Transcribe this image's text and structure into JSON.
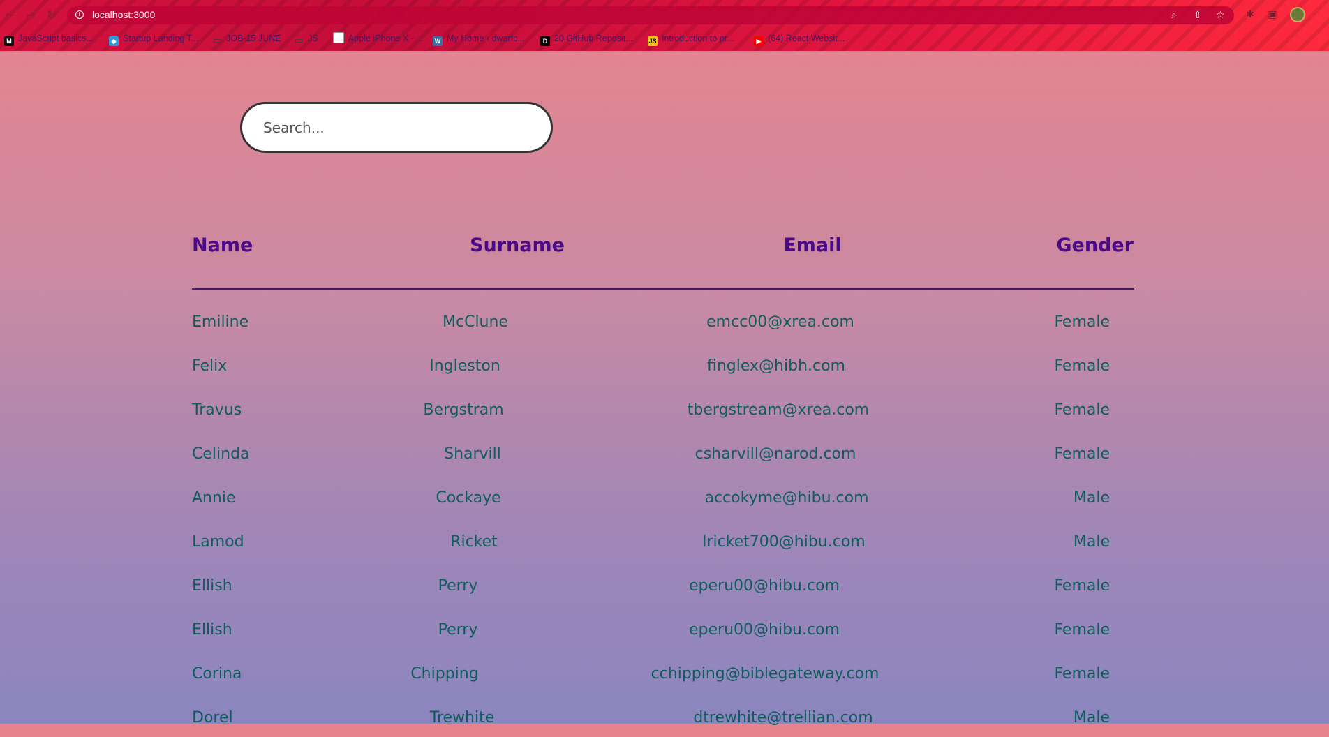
{
  "browser": {
    "url": "localhost:3000",
    "bookmarks": [
      {
        "label": "JavaScript basics...",
        "icon": "medium-icon",
        "color": "#111111"
      },
      {
        "label": "Startup Landing T...",
        "icon": "app-icon",
        "color": "#2a9bd8"
      },
      {
        "label": "JOB-15 JUNE",
        "icon": "folder-icon",
        "color": "#888888"
      },
      {
        "label": "JS",
        "icon": "folder-icon",
        "color": "#888888"
      },
      {
        "label": "Apple iPhone X - ...",
        "icon": "apple-icon",
        "color": "#ffffff"
      },
      {
        "label": "My Home ‹ dwarfc...",
        "icon": "wordpress-icon",
        "color": "#3a6ea5"
      },
      {
        "label": "20 GitHub Reposit...",
        "icon": "dev-icon",
        "color": "#000000"
      },
      {
        "label": "Introduction to pr...",
        "icon": "js-icon",
        "color": "#f0c419"
      },
      {
        "label": "(64) React Websit...",
        "icon": "youtube-icon",
        "color": "#ff0000"
      }
    ]
  },
  "search": {
    "placeholder": "Search..."
  },
  "table": {
    "headers": {
      "name": "Name",
      "surname": "Surname",
      "email": "Email",
      "gender": "Gender"
    },
    "rows": [
      {
        "name": "Emiline",
        "surname": "McClune",
        "email": "emcc00@xrea.com",
        "gender": "Female"
      },
      {
        "name": "Felix",
        "surname": "Ingleston",
        "email": "finglex@hibh.com",
        "gender": "Female"
      },
      {
        "name": "Travus",
        "surname": "Bergstram",
        "email": "tbergstream@xrea.com",
        "gender": "Female"
      },
      {
        "name": "Celinda",
        "surname": "Sharvill",
        "email": "csharvill@narod.com",
        "gender": "Female"
      },
      {
        "name": "Annie",
        "surname": "Cockaye",
        "email": "accokyme@hibu.com",
        "gender": "Male"
      },
      {
        "name": "Lamod",
        "surname": "Ricket",
        "email": "lricket700@hibu.com",
        "gender": "Male"
      },
      {
        "name": "Ellish",
        "surname": "Perry",
        "email": "eperu00@hibu.com",
        "gender": "Female"
      },
      {
        "name": "Ellish",
        "surname": "Perry",
        "email": "eperu00@hibu.com",
        "gender": "Female"
      },
      {
        "name": "Corina",
        "surname": "Chipping",
        "email": "cchipping@biblegateway.com",
        "gender": "Female"
      },
      {
        "name": "Dorel",
        "surname": "Trewhite",
        "email": "dtrewhite@trellian.com",
        "gender": "Male"
      }
    ]
  },
  "colors": {
    "header_text": "#4b0a8a",
    "cell_text": "#0f5e5b",
    "chrome_accent": "#d4123c"
  }
}
